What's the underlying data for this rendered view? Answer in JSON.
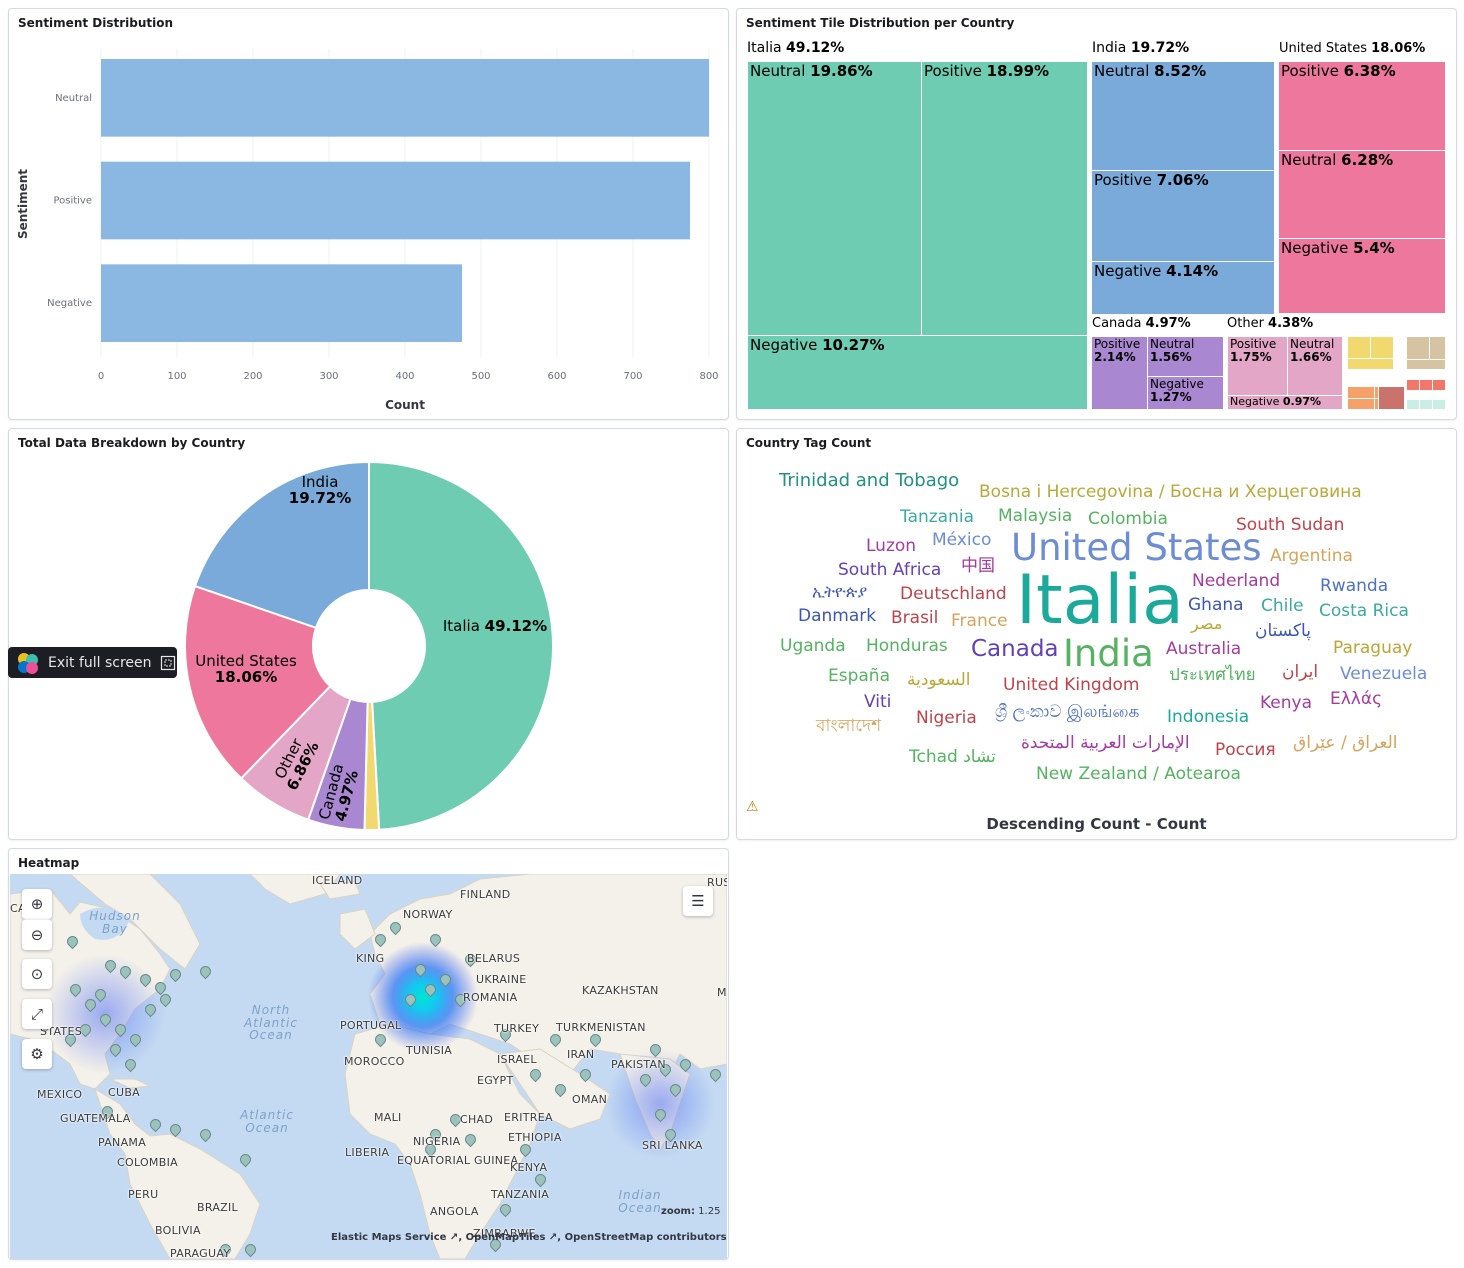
{
  "panels": {
    "sentiment_distribution": {
      "title": "Sentiment Distribution"
    },
    "tile_distribution": {
      "title": "Sentiment Tile Distribution per Country"
    },
    "breakdown": {
      "title": "Total Data Breakdown by Country"
    },
    "tag_count": {
      "title": "Country Tag Count",
      "footer": "Descending Count - Count"
    },
    "heatmap": {
      "title": "Heatmap"
    }
  },
  "chart_data": [
    {
      "type": "bar",
      "orientation": "horizontal",
      "categories": [
        "Neutral",
        "Positive",
        "Negative"
      ],
      "values": [
        800,
        775,
        475
      ],
      "xlabel": "Count",
      "ylabel": "Sentiment",
      "xlim": [
        0,
        800
      ],
      "xticks": [
        "0",
        "100",
        "200",
        "300",
        "400",
        "500",
        "600",
        "700",
        "800"
      ],
      "color": "#8bb8e3"
    },
    {
      "type": "treemap",
      "groups": [
        {
          "name": "Italia",
          "pct": "49.12%",
          "color": "#6dccb1",
          "children": [
            {
              "name": "Neutral",
              "pct": "19.86%"
            },
            {
              "name": "Positive",
              "pct": "18.99%"
            },
            {
              "name": "Negative",
              "pct": "10.27%"
            }
          ]
        },
        {
          "name": "India",
          "pct": "19.72%",
          "color": "#79aad9",
          "children": [
            {
              "name": "Neutral",
              "pct": "8.52%"
            },
            {
              "name": "Positive",
              "pct": "7.06%"
            },
            {
              "name": "Negative",
              "pct": "4.14%"
            }
          ]
        },
        {
          "name": "United States",
          "pct": "18.06%",
          "color": "#ee789d",
          "children": [
            {
              "name": "Positive",
              "pct": "6.38%"
            },
            {
              "name": "Neutral",
              "pct": "6.28%"
            },
            {
              "name": "Negative",
              "pct": "5.4%"
            }
          ]
        },
        {
          "name": "Canada",
          "pct": "4.97%",
          "color": "#a987d1",
          "children": [
            {
              "name": "Positive",
              "pct": "2.14%"
            },
            {
              "name": "Neutral",
              "pct": "1.56%"
            },
            {
              "name": "Negative",
              "pct": "1.27%"
            }
          ]
        },
        {
          "name": "Other",
          "pct": "4.38%",
          "color": "#e4a6c7",
          "children": [
            {
              "name": "Positive",
              "pct": "1.75%"
            },
            {
              "name": "Neutral",
              "pct": "1.66%"
            },
            {
              "name": "Negative",
              "pct": "0.97%"
            }
          ]
        }
      ]
    },
    {
      "type": "pie",
      "donut": true,
      "slices": [
        {
          "label": "Italia",
          "pct": "49.12%",
          "value": 49.12,
          "color": "#6dccb1"
        },
        {
          "label": "",
          "pct": "",
          "value": 1.27,
          "color": "#f1d86f"
        },
        {
          "label": "Canada",
          "pct": "4.97%",
          "value": 4.97,
          "color": "#a987d1"
        },
        {
          "label": "Other",
          "pct": "6.86%",
          "value": 6.86,
          "color": "#e4a6c7"
        },
        {
          "label": "United States",
          "pct": "18.06%",
          "value": 18.06,
          "color": "#ee789d"
        },
        {
          "label": "India",
          "pct": "19.72%",
          "value": 19.72,
          "color": "#79aad9"
        }
      ]
    }
  ],
  "word_cloud": [
    {
      "text": "Trinidad and Tobago",
      "color": "#209280"
    },
    {
      "text": "Bosna i Hercegovina / Босна и Херцеговина",
      "color": "#b9a838"
    },
    {
      "text": "Tanzania",
      "color": "#3aa9a0"
    },
    {
      "text": "Malaysia",
      "color": "#54b360"
    },
    {
      "text": "Colombia",
      "color": "#54b360"
    },
    {
      "text": "South Sudan",
      "color": "#c0424b"
    },
    {
      "text": "Luzon",
      "color": "#a53aa0"
    },
    {
      "text": "México",
      "color": "#6c8cd4"
    },
    {
      "text": "United States",
      "color": "#6c8cd4"
    },
    {
      "text": "Argentina",
      "color": "#d6a35b"
    },
    {
      "text": "South Africa",
      "color": "#6240b5"
    },
    {
      "text": "中国",
      "color": "#a53aa0"
    },
    {
      "text": "Italia",
      "color": "#1aa99a"
    },
    {
      "text": "Nederland",
      "color": "#a53aa0"
    },
    {
      "text": "Rwanda",
      "color": "#4d6fc4"
    },
    {
      "text": "ኢትዮጵያ",
      "color": "#3d55b5"
    },
    {
      "text": "Deutschland",
      "color": "#c0424b"
    },
    {
      "text": "Ghana",
      "color": "#3d55b5"
    },
    {
      "text": "Chile",
      "color": "#3aa9a0"
    },
    {
      "text": "Costa Rica",
      "color": "#3aa9a0"
    },
    {
      "text": "Danmark",
      "color": "#3d55b5"
    },
    {
      "text": "Brasil",
      "color": "#c0424b"
    },
    {
      "text": "France",
      "color": "#d6a35b"
    },
    {
      "text": "مصر",
      "color": "#b9a838"
    },
    {
      "text": "پاکستان",
      "color": "#3d55b5"
    },
    {
      "text": "Uganda",
      "color": "#54b360"
    },
    {
      "text": "Honduras",
      "color": "#54b360"
    },
    {
      "text": "Canada",
      "color": "#6240b5"
    },
    {
      "text": "India",
      "color": "#54b360"
    },
    {
      "text": "Australia",
      "color": "#a53aa0"
    },
    {
      "text": "Paraguay",
      "color": "#b9a838"
    },
    {
      "text": "España",
      "color": "#54b360"
    },
    {
      "text": "السعودية",
      "color": "#b9a838"
    },
    {
      "text": "United Kingdom",
      "color": "#c0424b"
    },
    {
      "text": "ประเทศไทย",
      "color": "#54b360"
    },
    {
      "text": "ایران",
      "color": "#c0424b"
    },
    {
      "text": "Venezuela",
      "color": "#6c8cd4"
    },
    {
      "text": "Viti",
      "color": "#6240b5"
    },
    {
      "text": "Kenya",
      "color": "#a53aa0"
    },
    {
      "text": "Ελλάς",
      "color": "#a53aa0"
    },
    {
      "text": "বাংলাদেশ",
      "color": "#d6a35b"
    },
    {
      "text": "Nigeria",
      "color": "#c0424b"
    },
    {
      "text": "ශ්‍රී ලංකාව இலங்கை",
      "color": "#4d6fc4"
    },
    {
      "text": "Indonesia",
      "color": "#1aa99a"
    },
    {
      "text": "Tchad تشاد",
      "color": "#54b360"
    },
    {
      "text": "الإمارات العربية المتحدة",
      "color": "#a53aa0"
    },
    {
      "text": "Россия",
      "color": "#c0424b"
    },
    {
      "text": "العراق / عێراق",
      "color": "#d6a35b"
    },
    {
      "text": "New Zealand / Aotearoa",
      "color": "#54b360"
    }
  ],
  "tooltip": {
    "label": "Exit full screen"
  },
  "map": {
    "zoom_label": "zoom:",
    "zoom_value": "1.25",
    "attribution": [
      "Elastic Maps Service",
      "OpenMapTiles",
      "OpenStreetMap contributors"
    ],
    "labels": [
      "ICELAND",
      "FINLAND",
      "NORWAY",
      "BELARUS",
      "UKRAINE",
      "KAZAKHSTAN",
      "ROMANIA",
      "PORTUGAL",
      "TURKEY",
      "TURKMENISTAN",
      "MOROCCO",
      "TUNISIA",
      "ISRAEL",
      "IRAN",
      "PAKISTAN",
      "EGYPT",
      "OMAN",
      "MALI",
      "CHAD",
      "ERITREA",
      "ETHIOPIA",
      "NIGERIA",
      "LIBERIA",
      "EQUATORIAL GUINEA",
      "KENYA",
      "TANZANIA",
      "ANGOLA",
      "ZIMBABWE",
      "SRI LANKA",
      "MEXICO",
      "CUBA",
      "GUATEMALA",
      "PANAMA",
      "COLOMBIA",
      "PERU",
      "BRAZIL",
      "BOLIVIA",
      "PARAGUAY",
      "STATES",
      "KING",
      "RUS",
      "CA",
      "M"
    ],
    "oceans": [
      "Hudson Bay",
      "North Atlantic Ocean",
      "Atlantic Ocean",
      "Indian Ocean"
    ]
  }
}
